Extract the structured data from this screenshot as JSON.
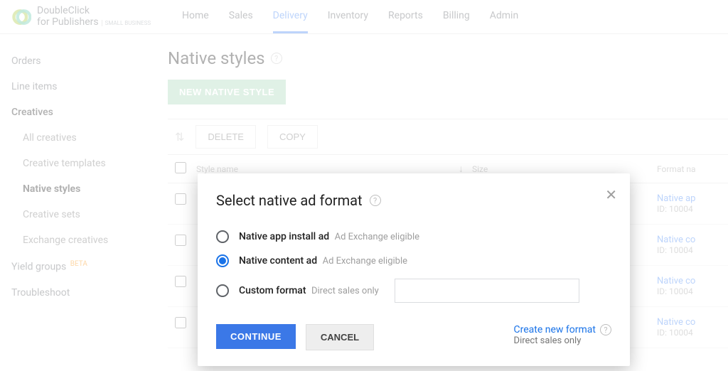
{
  "brand": {
    "line1": "DoubleClick",
    "line2": "for Publishers",
    "sub": "SMALL BUSINESS"
  },
  "nav": {
    "items": [
      {
        "label": "Home"
      },
      {
        "label": "Sales"
      },
      {
        "label": "Delivery"
      },
      {
        "label": "Inventory"
      },
      {
        "label": "Reports"
      },
      {
        "label": "Billing"
      },
      {
        "label": "Admin"
      }
    ]
  },
  "sidebar": {
    "orders": "Orders",
    "line_items": "Line items",
    "creatives": "Creatives",
    "sub": {
      "all": "All creatives",
      "templates": "Creative templates",
      "native": "Native styles",
      "sets": "Creative sets",
      "exchange": "Exchange creatives"
    },
    "yield": "Yield groups",
    "beta": "BETA",
    "troubleshoot": "Troubleshoot"
  },
  "page": {
    "title": "Native styles",
    "new_btn": "NEW NATIVE STYLE",
    "delete": "DELETE",
    "copy": "COPY",
    "cols": {
      "style": "Style name",
      "size": "Size",
      "format": "Format na"
    }
  },
  "rows": [
    {
      "title": "Native ap",
      "id": "ID: 10004"
    },
    {
      "title": "Native co",
      "id": "ID: 10004"
    },
    {
      "title": "Native co",
      "id": "ID: 10004"
    },
    {
      "title": "Native co",
      "id": "ID: 10004"
    }
  ],
  "modal": {
    "title": "Select native ad format",
    "options": [
      {
        "label": "Native app install ad",
        "hint": "Ad Exchange eligible"
      },
      {
        "label": "Native content ad",
        "hint": "Ad Exchange eligible"
      },
      {
        "label": "Custom format",
        "hint": "Direct sales only"
      }
    ],
    "continue": "CONTINUE",
    "cancel": "CANCEL",
    "create_link": "Create new format",
    "create_sub": "Direct sales only"
  }
}
